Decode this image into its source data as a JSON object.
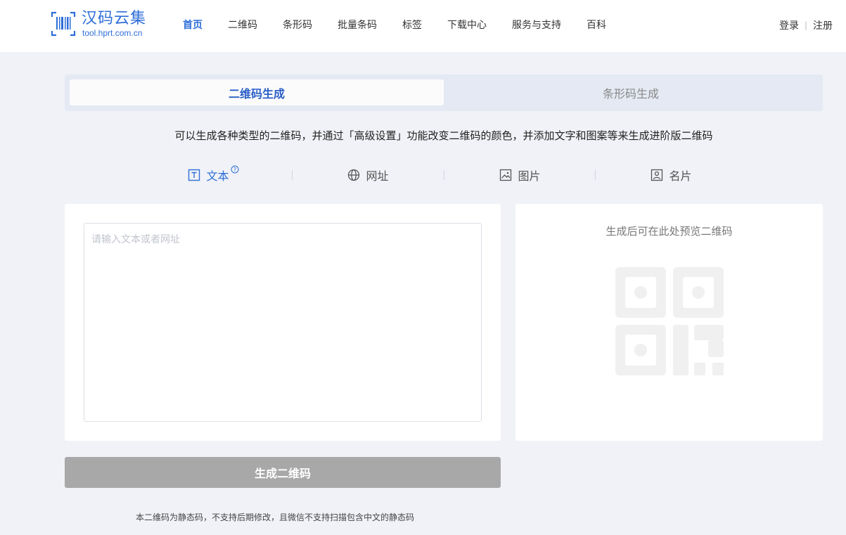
{
  "header": {
    "logo_title": "汉码云集",
    "logo_url": "tool.hprt.com.cn",
    "nav": [
      {
        "label": "首页",
        "active": true
      },
      {
        "label": "二维码",
        "active": false
      },
      {
        "label": "条形码",
        "active": false
      },
      {
        "label": "批量条码",
        "active": false
      },
      {
        "label": "标签",
        "active": false
      },
      {
        "label": "下载中心",
        "active": false
      },
      {
        "label": "服务与支持",
        "active": false
      },
      {
        "label": "百科",
        "active": false
      }
    ],
    "login": "登录",
    "separator": "|",
    "register": "注册"
  },
  "main_tabs": {
    "qr": "二维码生成",
    "barcode": "条形码生成",
    "active": "qr"
  },
  "description": "可以生成各种类型的二维码，并通过「高级设置」功能改变二维码的颜色，并添加文字和图案等来生成进阶版二维码",
  "type_tabs": [
    {
      "label": "文本",
      "icon": "text-icon",
      "active": true
    },
    {
      "label": "网址",
      "icon": "globe-icon",
      "active": false
    },
    {
      "label": "图片",
      "icon": "image-icon",
      "active": false
    },
    {
      "label": "名片",
      "icon": "contact-card-icon",
      "active": false
    }
  ],
  "help_icon": "?",
  "input": {
    "placeholder": "请输入文本或者网址",
    "value": ""
  },
  "preview": {
    "hint": "生成后可在此处预览二维码"
  },
  "generate_button": "生成二维码",
  "note": "本二维码为静态码，不支持后期修改，且微信不支持扫描包含中文的静态码",
  "colors": {
    "accent": "#2e6ed8",
    "page_bg": "#f0f2f7",
    "button_disabled": "#a8a8a8",
    "qr_placeholder": "#f0f0f0"
  }
}
